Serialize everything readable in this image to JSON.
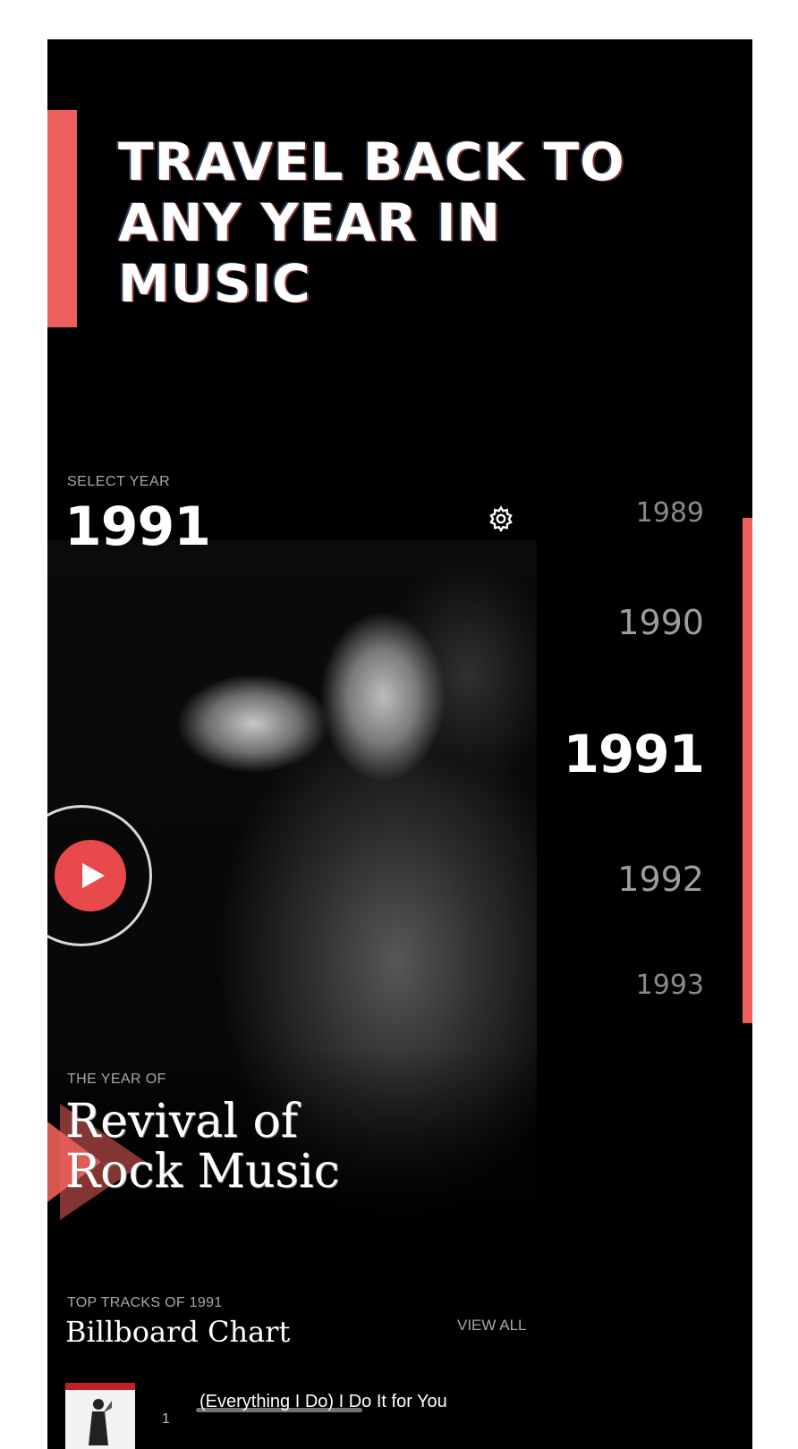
{
  "hero": {
    "headline": "TRAVEL BACK TO ANY YEAR IN MUSIC"
  },
  "year_picker": {
    "label": "SELECT YEAR",
    "selected": "1991",
    "years": [
      "1989",
      "1990",
      "1991",
      "1992",
      "1993"
    ]
  },
  "feature": {
    "label": "THE YEAR OF",
    "theme_line1": "Revival of",
    "theme_line2": "Rock Music"
  },
  "tracks": {
    "label": "TOP TRACKS OF 1991",
    "title": "Billboard Chart",
    "view_all": "VIEW ALL",
    "items": [
      {
        "rank": "1",
        "title": "(Everything I Do) I Do It for You"
      }
    ]
  },
  "icons": {
    "settings": "gear-icon",
    "play": "play-icon"
  },
  "colors": {
    "accent": "#ec605b",
    "play": "#e8494a",
    "background": "#000000",
    "text": "#ffffff",
    "muted": "#a8a8a8"
  }
}
